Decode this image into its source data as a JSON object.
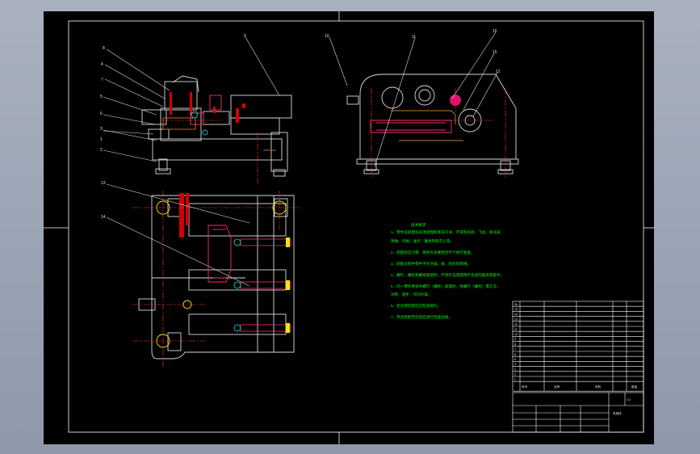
{
  "drawing": {
    "part_numbers_front": [
      "8",
      "4",
      "7",
      "5",
      "6",
      "3",
      "2",
      "1"
    ],
    "part_number_top": "9",
    "part_numbers_side": [
      "10",
      "11",
      "16",
      "15",
      "12"
    ],
    "part_numbers_plan": [
      "13",
      "14"
    ],
    "notes_title": "技术要求",
    "notes_lines": [
      "1、零件在装配前必须清理和清洗干净，不得有毛刺、飞边、氧化皮",
      "锈蚀、切屑、油污、着色剂和灰尘等。",
      "2、装配前应对零、部件的主要配合尺寸进行复查。",
      "3、装配过程中零件不允许磕、碰、划伤和锈蚀。",
      "4、螺钉、螺栓和螺母紧固时，严禁打击或使用不合适的旋具和扳手。",
      "5、同一零件用多件螺钉（螺栓）紧固时，各螺钉（螺栓）需交叉、",
      "对称、逐步、均匀拧紧。",
      "6、定位销装配前应检查销孔。",
      "7、夹具装配完毕后应进行检查验收。"
    ],
    "bom_seq": [
      "16",
      "15",
      "14",
      "13",
      "12",
      "11",
      "10",
      "9",
      "8",
      "7",
      "6",
      "5",
      "4",
      "3",
      "2",
      "1"
    ],
    "title_block": {
      "header_seq": "序号",
      "header_name": "名称",
      "header_material": "材料",
      "header_qty": "数量",
      "scale": "1:2",
      "drawing_title": "夹具体"
    }
  }
}
